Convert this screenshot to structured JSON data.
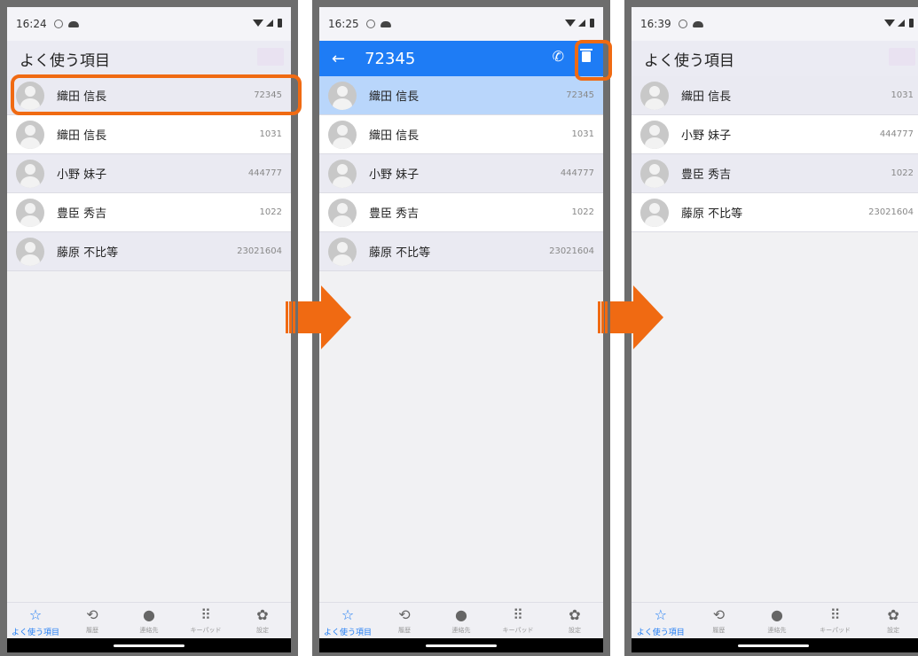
{
  "screens": [
    {
      "status": {
        "time": "16:24"
      },
      "header": {
        "title": "よく使う項目"
      },
      "rows": [
        {
          "name": "織田 信長",
          "number": "72345"
        },
        {
          "name": "織田 信長",
          "number": "1031"
        },
        {
          "name": "小野 妹子",
          "number": "444777"
        },
        {
          "name": "豊臣 秀吉",
          "number": "1022"
        },
        {
          "name": "藤原 不比等",
          "number": "23021604"
        }
      ]
    },
    {
      "status": {
        "time": "16:25"
      },
      "header": {
        "back_icon": "←",
        "title": "72345",
        "call_icon": "phone-icon",
        "delete_icon": "trash-icon"
      },
      "rows": [
        {
          "name": "織田 信長",
          "number": "72345"
        },
        {
          "name": "織田 信長",
          "number": "1031"
        },
        {
          "name": "小野 妹子",
          "number": "444777"
        },
        {
          "name": "豊臣 秀吉",
          "number": "1022"
        },
        {
          "name": "藤原 不比等",
          "number": "23021604"
        }
      ]
    },
    {
      "status": {
        "time": "16:39"
      },
      "header": {
        "title": "よく使う項目"
      },
      "rows": [
        {
          "name": "織田 信長",
          "number": "1031"
        },
        {
          "name": "小野 妹子",
          "number": "444777"
        },
        {
          "name": "豊臣 秀吉",
          "number": "1022"
        },
        {
          "name": "藤原 不比等",
          "number": "23021604"
        }
      ]
    }
  ],
  "tabs": [
    {
      "label": "よく使う項目",
      "icon": "☆"
    },
    {
      "label": "履歴",
      "icon": "⟲"
    },
    {
      "label": "連絡先",
      "icon": "●"
    },
    {
      "label": "キーパッド",
      "icon": "⠿"
    },
    {
      "label": "設定",
      "icon": "✿"
    }
  ],
  "colors": {
    "accent": "#1e7cf5",
    "highlight": "#f06a12",
    "selected_row": "#b9d6fb"
  }
}
